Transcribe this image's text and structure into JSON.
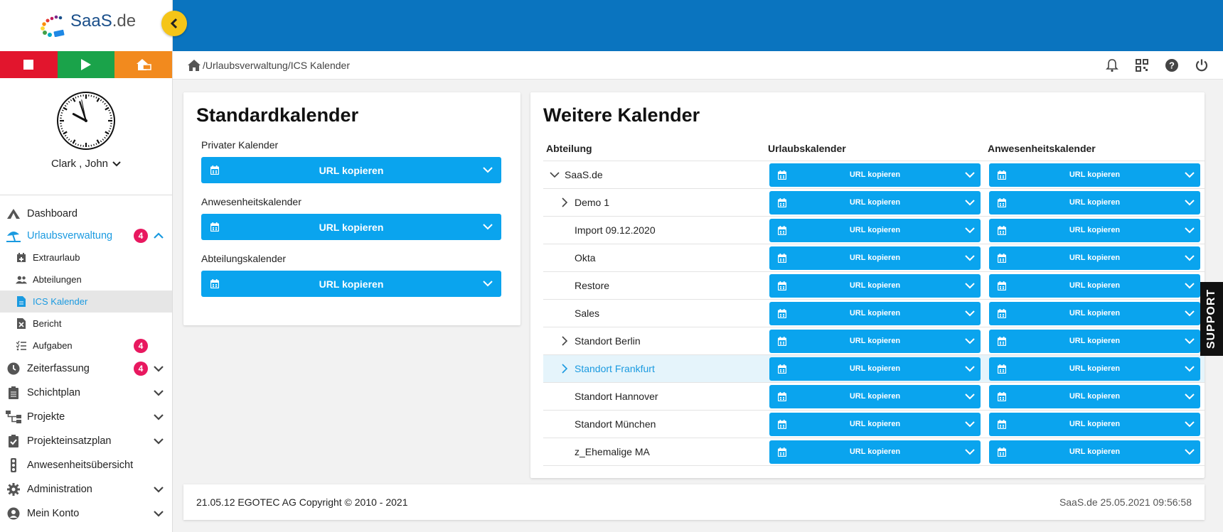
{
  "brand": {
    "logo_text_a": "SaaS",
    "logo_text_b": ".de"
  },
  "user": {
    "name": "Clark , John"
  },
  "colors": {
    "topbar": "#0a74bf",
    "accent": "#0aa4ee",
    "badge": "#e8185f",
    "stop": "#e2152d",
    "play": "#1aa34a",
    "home": "#f28a1e",
    "collapse": "#f5c518"
  },
  "clock": {
    "hour": 9,
    "minute": 56,
    "second": 58
  },
  "menu": [
    {
      "label": "Dashboard",
      "icon": "dashboard-icon"
    },
    {
      "label": "Urlaubsverwaltung",
      "icon": "beach-umbrella-icon",
      "badge": "4",
      "expanded": true
    },
    {
      "label": "Extraurlaub",
      "icon": "calendar-plus-icon",
      "sub": true
    },
    {
      "label": "Abteilungen",
      "icon": "users-icon",
      "sub": true
    },
    {
      "label": "ICS Kalender",
      "icon": "file-icon",
      "sub": true,
      "selected": true
    },
    {
      "label": "Bericht",
      "icon": "excel-file-icon",
      "sub": true
    },
    {
      "label": "Aufgaben",
      "icon": "checklist-icon",
      "sub": true,
      "badge": "4"
    },
    {
      "label": "Zeiterfassung",
      "icon": "clock-icon",
      "badge": "4"
    },
    {
      "label": "Schichtplan",
      "icon": "clipboard-icon"
    },
    {
      "label": "Projekte",
      "icon": "sitemap-icon"
    },
    {
      "label": "Projekteinsatzplan",
      "icon": "clipboard-check-icon"
    },
    {
      "label": "Anwesenheitsübersicht",
      "icon": "traffic-light-icon"
    },
    {
      "label": "Administration",
      "icon": "gear-icon"
    },
    {
      "label": "Mein Konto",
      "icon": "user-circle-icon"
    }
  ],
  "breadcrumb": "/Urlaubsverwaltung/ICS Kalender",
  "standard": {
    "title": "Standardkalender",
    "items": [
      {
        "label": "Privater Kalender",
        "button": "URL kopieren"
      },
      {
        "label": "Anwesenheitskalender",
        "button": "URL kopieren"
      },
      {
        "label": "Abteilungskalender",
        "button": "URL kopieren"
      }
    ]
  },
  "weitere": {
    "title": "Weitere Kalender",
    "headers": [
      "Abteilung",
      "Urlaubskalender",
      "Anwesenheitskalender"
    ],
    "rows": [
      {
        "name": "SaaS.de",
        "toggle": "down",
        "indent": 0,
        "btn1": "URL kopieren",
        "btn2": "URL kopieren"
      },
      {
        "name": "Demo 1",
        "toggle": "right",
        "indent": 1,
        "btn1": "URL kopieren",
        "btn2": "URL kopieren"
      },
      {
        "name": "Import 09.12.2020",
        "toggle": "",
        "indent": 1,
        "btn1": "URL kopieren",
        "btn2": "URL kopieren"
      },
      {
        "name": "Okta",
        "toggle": "",
        "indent": 1,
        "btn1": "URL kopieren",
        "btn2": "URL kopieren"
      },
      {
        "name": "Restore",
        "toggle": "",
        "indent": 1,
        "btn1": "URL kopieren",
        "btn2": "URL kopieren"
      },
      {
        "name": "Sales",
        "toggle": "",
        "indent": 1,
        "btn1": "URL kopieren",
        "btn2": "URL kopieren"
      },
      {
        "name": "Standort Berlin",
        "toggle": "right",
        "indent": 1,
        "btn1": "URL kopieren",
        "btn2": "URL kopieren"
      },
      {
        "name": "Standort Frankfurt",
        "toggle": "right",
        "indent": 1,
        "highlight": true,
        "btn1": "URL kopieren",
        "btn2": "URL kopieren"
      },
      {
        "name": "Standort Hannover",
        "toggle": "",
        "indent": 1,
        "btn1": "URL kopieren",
        "btn2": "URL kopieren"
      },
      {
        "name": "Standort München",
        "toggle": "",
        "indent": 1,
        "btn1": "URL kopieren",
        "btn2": "URL kopieren"
      },
      {
        "name": "z_Ehemalige MA",
        "toggle": "",
        "indent": 1,
        "btn1": "URL kopieren",
        "btn2": "URL kopieren"
      }
    ]
  },
  "footer": {
    "left": "21.05.12 EGOTEC AG Copyright © 2010 - 2021",
    "right": "SaaS.de  25.05.2021 09:56:58"
  },
  "support": "SUPPORT"
}
